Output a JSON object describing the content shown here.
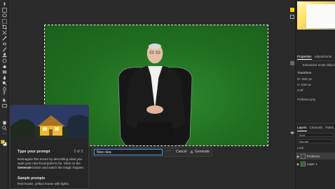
{
  "prompt_bar": {
    "input_value": "Nice clea",
    "more_label": "···",
    "cancel_label": "Cancel",
    "generate_label": "Generate"
  },
  "tutorial": {
    "title": "Type your prompt",
    "step": "2 of 3",
    "body_pre": "Reimagine this scene by describing what you want your new focal point to be. Click on the ",
    "body_bold": "Generate",
    "body_post": " button and watch the magic happen.",
    "sample_heading": "Sample prompts",
    "sample_text": "Red house, yellow house with lights."
  },
  "right_panel": {
    "tabs": [
      "Properties",
      "Adjustments"
    ],
    "object_type": "Embedded Smart Object",
    "transform_label": "Transform",
    "w_label": "W:",
    "w_value": "3840 px",
    "h_label": "H:",
    "h_value": "2160 px",
    "angle": "0.00°",
    "file_name": "Professor.png",
    "layers_tabs": [
      "Layers",
      "Channels",
      "Paths"
    ],
    "kind_label": "Kind",
    "blend_mode": "Normal",
    "lock_label": "Lock:",
    "layers": [
      {
        "name": "Professor",
        "selected": true
      },
      {
        "name": "Layer 1",
        "selected": false
      }
    ]
  },
  "colors": {
    "accent": "#4a90e2",
    "foreground": "#ffd100",
    "background": "#ffffff",
    "green_screen": "#1f6d1f"
  },
  "icons": {
    "toolbar": [
      "move-icon",
      "artboard-icon",
      "lasso-icon",
      "object-select-icon",
      "crop-icon",
      "frame-icon",
      "eyedropper-icon",
      "healing-icon",
      "brush-icon",
      "stamp-icon",
      "history-brush-icon",
      "eraser-icon",
      "gradient-icon",
      "blur-icon",
      "dodge-icon",
      "pen-icon",
      "type-icon",
      "path-select-icon",
      "rectangle-icon",
      "hand-icon",
      "zoom-icon",
      "more-tools-icon"
    ]
  }
}
